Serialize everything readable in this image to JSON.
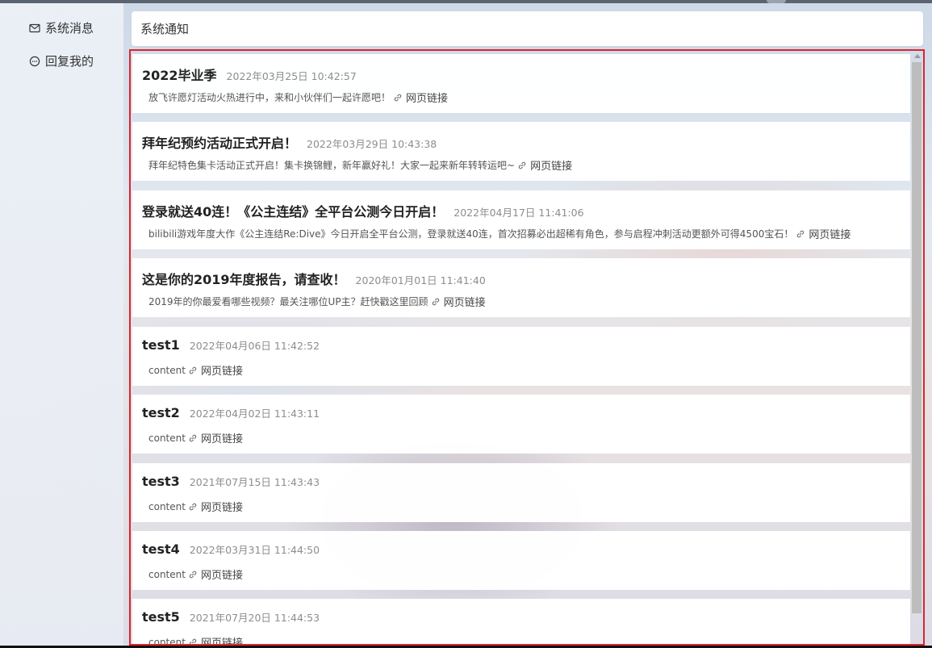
{
  "sidebar": {
    "items": [
      {
        "label": "系统消息",
        "icon": "mail-icon"
      },
      {
        "label": "回复我的",
        "icon": "chat-bubble-icon"
      }
    ]
  },
  "header": {
    "title": "系统通知"
  },
  "messages": [
    {
      "title": "2022毕业季",
      "time": "2022年03月25日 10:42:57",
      "content": "放飞许愿灯活动火热进行中，来和小伙伴们一起许愿吧！",
      "link_label": "网页链接"
    },
    {
      "title": "拜年纪预约活动正式开启！",
      "time": "2022年03月29日 10:43:38",
      "content": "拜年纪特色集卡活动正式开启！集卡换锦鲤，新年赢好礼！大家一起来新年转转运吧~",
      "link_label": "网页链接"
    },
    {
      "title": "登录就送40连！《公主连结》全平台公测今日开启！",
      "time": "2022年04月17日 11:41:06",
      "content": "bilibili游戏年度大作《公主连结Re:Dive》今日开启全平台公测，登录就送40连，首次招募必出超稀有角色，参与启程冲刺活动更额外可得4500宝石！",
      "link_label": "网页链接"
    },
    {
      "title": "这是你的2019年度报告，请查收！",
      "time": "2020年01月01日 11:41:40",
      "content": "2019年的你最爱看哪些视频？最关注哪位UP主？赶快戳这里回顾",
      "link_label": "网页链接"
    },
    {
      "title": "test1",
      "time": "2022年04月06日 11:42:52",
      "content": "content",
      "link_label": "网页链接"
    },
    {
      "title": "test2",
      "time": "2022年04月02日 11:43:11",
      "content": "content",
      "link_label": "网页链接"
    },
    {
      "title": "test3",
      "time": "2021年07月15日 11:43:43",
      "content": "content",
      "link_label": "网页链接"
    },
    {
      "title": "test4",
      "time": "2022年03月31日 11:44:50",
      "content": "content",
      "link_label": "网页链接"
    },
    {
      "title": "test5",
      "time": "2021年07月20日 11:44:53",
      "content": "content",
      "link_label": "网页链接"
    }
  ]
}
